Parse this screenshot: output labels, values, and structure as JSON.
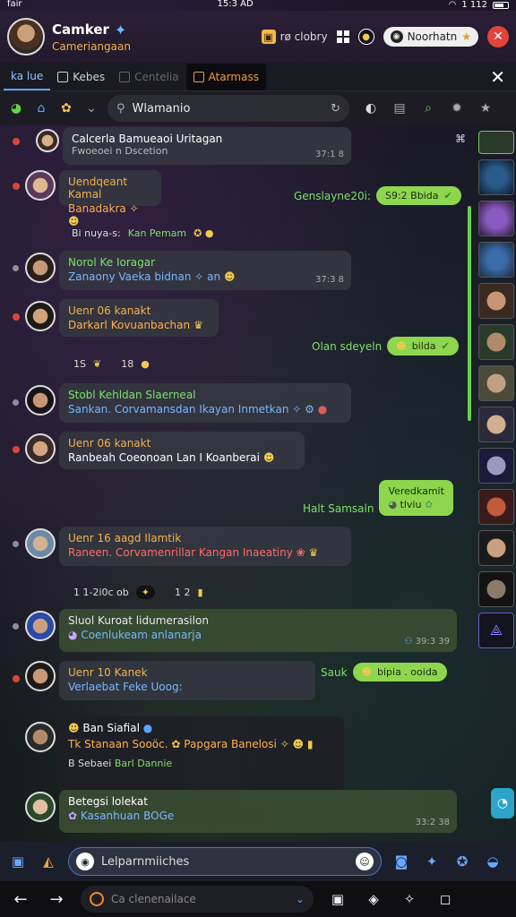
{
  "status": {
    "left": "fair",
    "time": "15:3 AD",
    "right": "1 112"
  },
  "header": {
    "title": "Camker",
    "subtitle": "Cameriangaan",
    "chip_label": "rø clobry",
    "pill_label": "Noorhatn",
    "avatar_icon": "user-avatar",
    "colors": {
      "accent": "#f2b24a",
      "close": "#e0443a"
    }
  },
  "tabs": [
    {
      "label": "ka lue"
    },
    {
      "label": "Kebes"
    },
    {
      "label": "Centelia"
    },
    {
      "label": "Atarmass"
    }
  ],
  "toolbar": {
    "search_value": "Wlamanio"
  },
  "messages": [
    {
      "name": "Calcerla Bamueaoi Uritagan",
      "text": "Fwoeoei n Dscetion",
      "time": "37:1 8"
    },
    {
      "name": "Uendqeant Kamal",
      "text": "Banadakra"
    },
    {
      "name": "Norol Ke Ioragar",
      "text": "Zanaony Vaeka bidnan",
      "time": "37:3 8"
    },
    {
      "name": "Uenr 06 kanakt",
      "text": "Darkarl Kovuanbachan"
    },
    {
      "name": "Stobl Kehldan Slaerneal",
      "text": "Sankan. Corvamansdan Ikayan Inmetkan"
    },
    {
      "name": "Uenr 06 kanakt",
      "text": "Ranbeah Coeonoan Lan I Koanberai"
    },
    {
      "name": "Uenr 16 aagd Ilamtik",
      "text": "Raneen. Corvamenrillar Kangan Inaeatiny"
    },
    {
      "name": "Sluol Kuroat lidumerasilon",
      "text": "Coenlukeam anlanarja",
      "time": "39:3 39"
    },
    {
      "name": "Uenr 10 Kanek",
      "text": "Verlaebat Feke Uoog:"
    },
    {
      "name": "Ban Siafial",
      "text": "Tk Stanaan Sooöc.",
      "text2": "Papgara Banelosi",
      "sub": "B Sebaei",
      "sub_green": "Barl Dannie"
    },
    {
      "name": "Betegsi lolekat",
      "text": "Kasanhuan BOGe",
      "time": "33:2 38"
    }
  ],
  "outgoing": [
    {
      "label": "Genslayne20i:",
      "text": "S9:2 Bbida"
    },
    {
      "label": "Olan sdeyeln",
      "text": "bilda"
    },
    {
      "label": "Halt Samsaln",
      "line1": "Veredkamit",
      "line2": "tlviu"
    },
    {
      "label": "Sauk",
      "text": "bipia . ooida"
    }
  ],
  "system": [
    {
      "text": "Bi nuya-s:",
      "green": "Kan Pemam"
    },
    {
      "text": "1S",
      "green": "18"
    },
    {
      "text": "1 1-2i0c ob",
      "green": "1 2"
    }
  ],
  "composer": {
    "placeholder": "Lelparnmiiches"
  },
  "browser": {
    "url": "Ca clenenailace"
  }
}
